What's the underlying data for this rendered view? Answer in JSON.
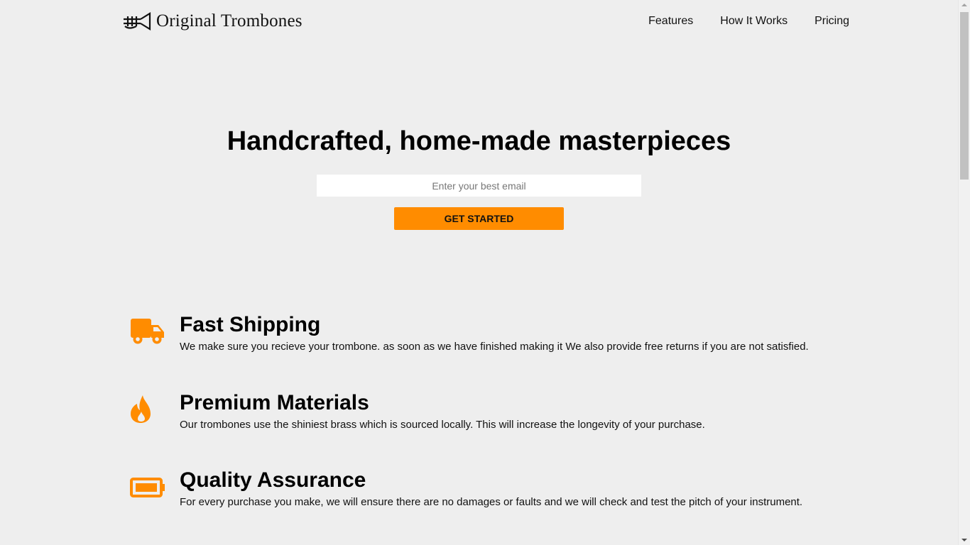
{
  "brand": {
    "name": "Original Trombones",
    "logo_icon": "trombone-icon"
  },
  "nav": {
    "items": [
      {
        "label": "Features"
      },
      {
        "label": "How It Works"
      },
      {
        "label": "Pricing"
      }
    ]
  },
  "hero": {
    "title": "Handcrafted, home-made masterpieces",
    "email_placeholder": "Enter your best email",
    "email_value": "",
    "cta_label": "GET STARTED"
  },
  "features": [
    {
      "icon": "truck-icon",
      "title": "Fast Shipping",
      "description": "We make sure you recieve your trombone. as soon as we have finished making it We also provide free returns if you are not satisfied."
    },
    {
      "icon": "fire-icon",
      "title": "Premium Materials",
      "description": "Our trombones use the shiniest brass which is sourced locally. This will increase the longevity of your purchase."
    },
    {
      "icon": "battery-icon",
      "title": "Quality Assurance",
      "description": "For every purchase you make, we will ensure there are no damages or faults and we will check and test the pitch of your instrument."
    }
  ],
  "colors": {
    "accent": "#ff8c00",
    "background": "#eeeeee",
    "text": "#000000"
  }
}
